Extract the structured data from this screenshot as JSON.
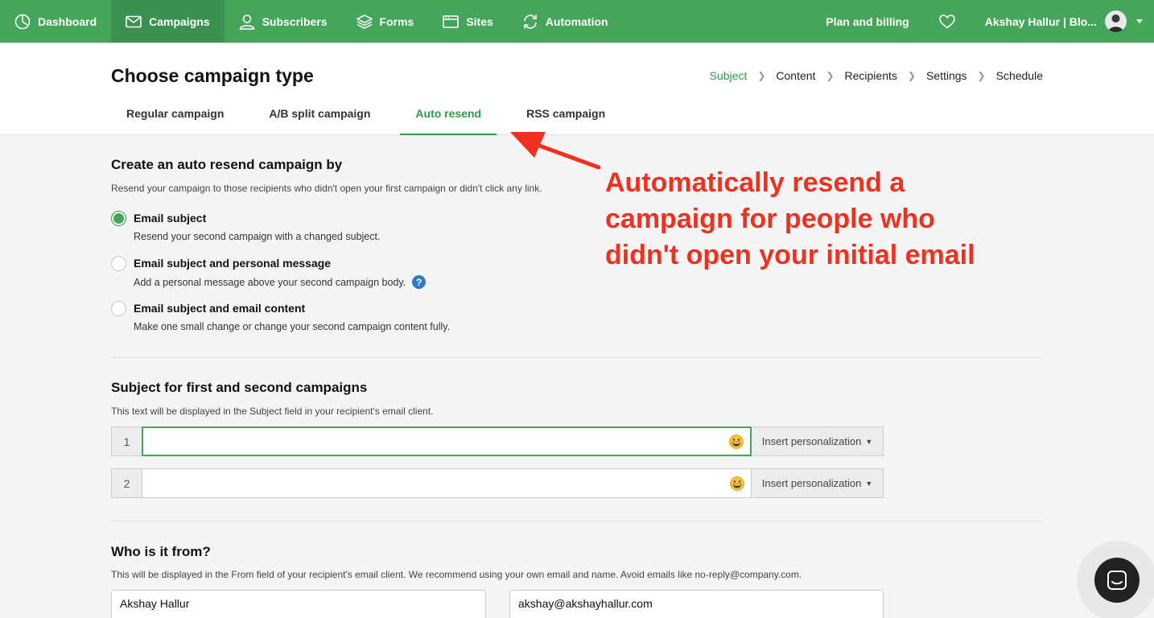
{
  "nav": {
    "items": [
      {
        "label": "Dashboard",
        "icon": "dashboard-icon",
        "active": false
      },
      {
        "label": "Campaigns",
        "icon": "envelope-icon",
        "active": true
      },
      {
        "label": "Subscribers",
        "icon": "user-icon",
        "active": false
      },
      {
        "label": "Forms",
        "icon": "layers-icon",
        "active": false
      },
      {
        "label": "Sites",
        "icon": "browser-icon",
        "active": false
      },
      {
        "label": "Automation",
        "icon": "refresh-icon",
        "active": false
      }
    ],
    "plan_billing": "Plan and billing",
    "account_name": "Akshay Hallur | Blo..."
  },
  "header": {
    "title": "Choose campaign type",
    "breadcrumb": [
      "Subject",
      "Content",
      "Recipients",
      "Settings",
      "Schedule"
    ],
    "tabs": [
      "Regular campaign",
      "A/B split campaign",
      "Auto resend",
      "RSS campaign"
    ],
    "active_tab": "Auto resend"
  },
  "resend": {
    "title": "Create an auto resend campaign by",
    "desc": "Resend your campaign to those recipients who didn't open your first campaign or didn't click any link.",
    "options": [
      {
        "label": "Email subject",
        "help": "Resend your second campaign with a changed subject.",
        "checked": true
      },
      {
        "label": "Email subject and personal message",
        "help": "Add a personal message above your second campaign body.",
        "checked": false
      },
      {
        "label": "Email subject and email content",
        "help": "Make one small change or change your second campaign content fully.",
        "checked": false
      }
    ]
  },
  "subjects": {
    "title": "Subject for first and second campaigns",
    "desc": "This text will be displayed in the Subject field in your recipient's email client.",
    "rows": [
      {
        "num": "1",
        "value": "",
        "button": "Insert personalization"
      },
      {
        "num": "2",
        "value": "",
        "button": "Insert personalization"
      }
    ]
  },
  "from": {
    "title": "Who is it from?",
    "desc": "This will be displayed in the From field of your recipient's email client. We recommend using your own email and name. Avoid emails like no-reply@company.com.",
    "name": "Akshay Hallur",
    "email": "akshay@akshayhallur.com"
  },
  "annotation": {
    "lines": [
      "Automatically resend a",
      "campaign for people who",
      "didn't open your initial email"
    ],
    "color": "#f0311f"
  },
  "colors": {
    "brand_green": "#45a55a",
    "active_green": "#2e9a47",
    "help_blue": "#2f7ac6"
  }
}
